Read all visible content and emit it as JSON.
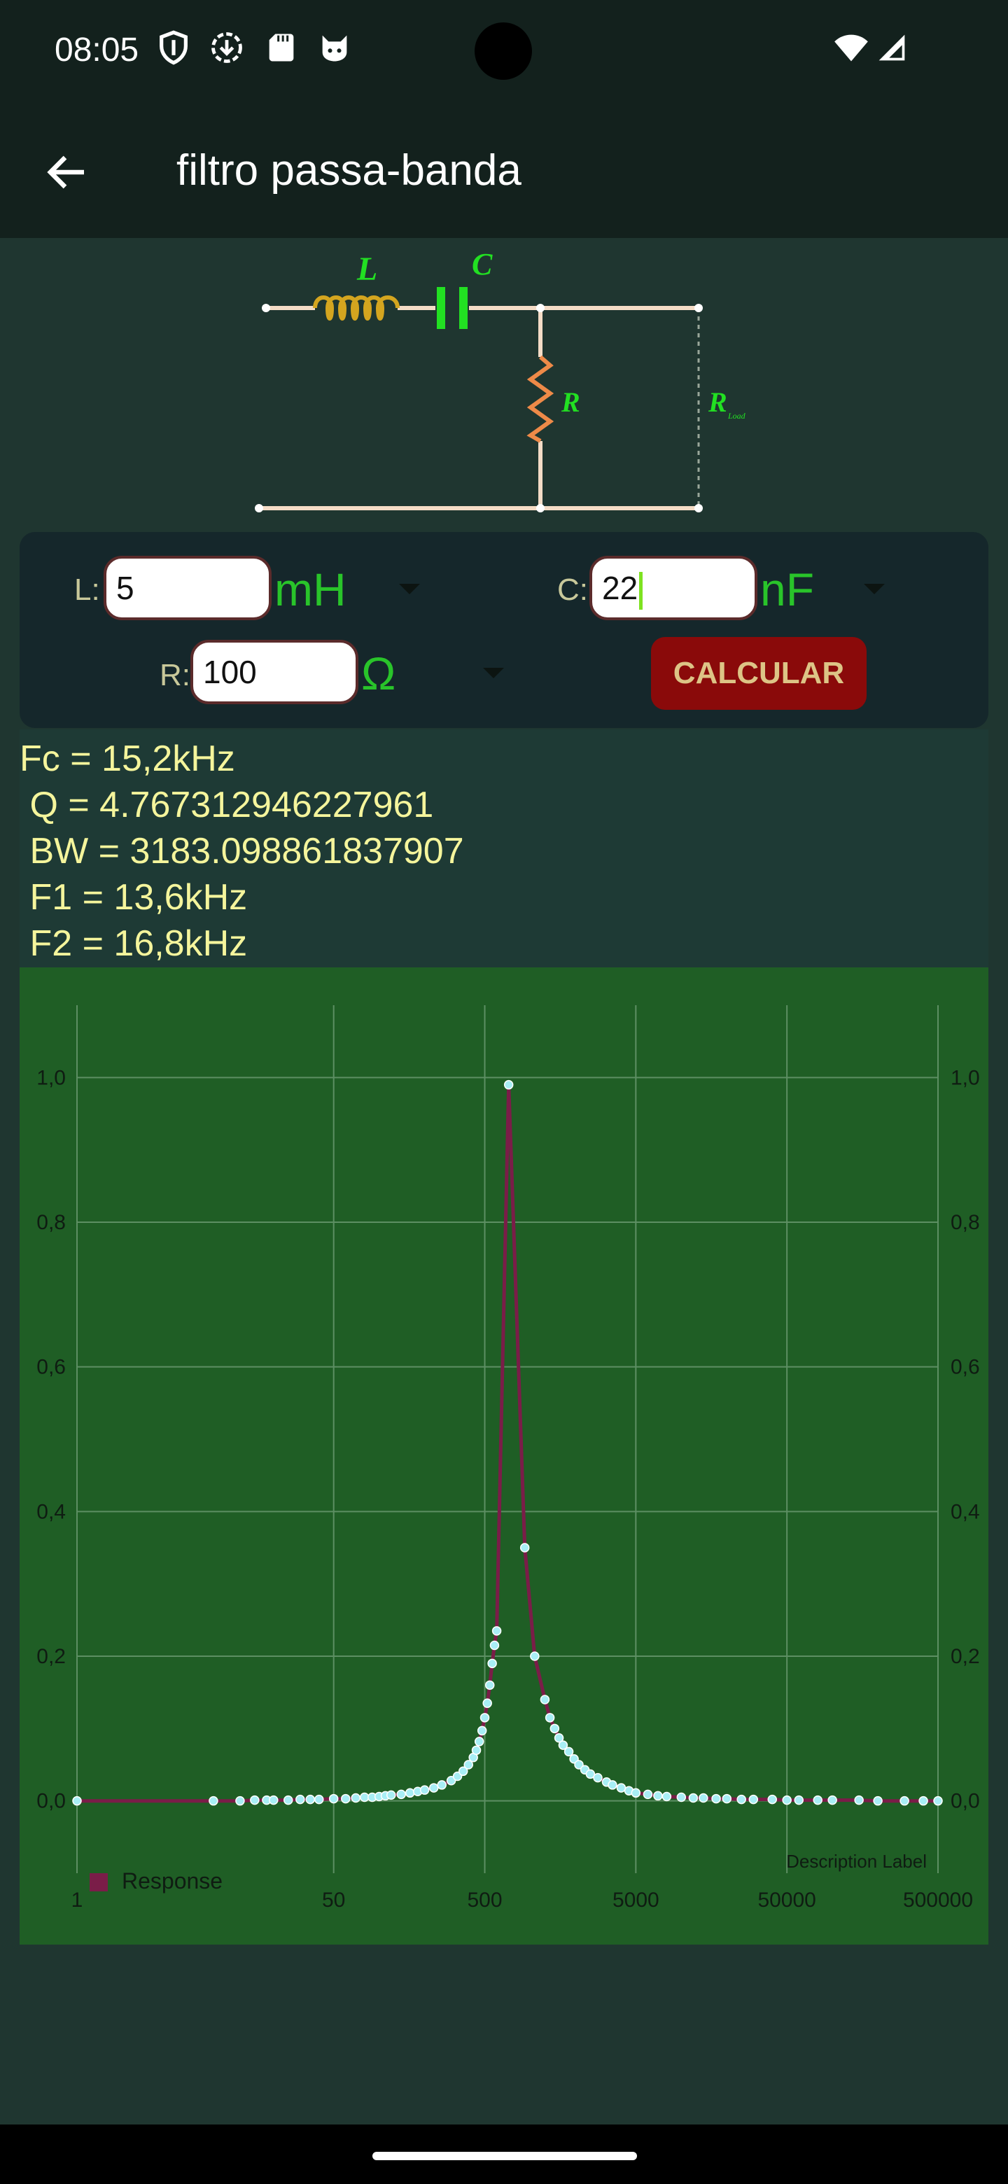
{
  "status_bar": {
    "time": "08:05",
    "icons": [
      "shield-icon",
      "download-icon",
      "sd-card-icon",
      "cat-face-icon",
      "wifi-icon",
      "signal-icon"
    ]
  },
  "app_bar": {
    "title": "filtro passa-banda",
    "back_icon": "arrow-left-icon"
  },
  "circuit": {
    "label_l": "L",
    "label_c": "C",
    "label_r": "R",
    "label_rload": "R",
    "label_rload_sub": "Load"
  },
  "form": {
    "l_label": "L:",
    "l_value": "5",
    "l_unit": "mH",
    "c_label": "C:",
    "c_value": "22",
    "c_unit": "nF",
    "r_label": "R:",
    "r_value": "100",
    "r_unit": "Ω",
    "calc_button": "CALCULAR"
  },
  "results": {
    "fc": "Fc = 15,2kHz",
    "q": " Q = 4.767312946227961",
    "bw": " BW = 3183.098861837907",
    "f1": " F1 = 13,6kHz",
    "f2": " F2 = 16,8kHz"
  },
  "chart_data": {
    "type": "line",
    "x_scale": "log",
    "x_ticks": [
      "1",
      "50",
      "500",
      "5000",
      "50000",
      "500000"
    ],
    "y_ticks": [
      "0,0",
      "0,2",
      "0,4",
      "0,6",
      "0,8",
      "1,0"
    ],
    "ylim": [
      -0.1,
      1.1
    ],
    "description_label": "Description Label",
    "legend": "Response",
    "legend_placement": "bottom-left",
    "grid": true,
    "series": [
      {
        "name": "Response",
        "points": [
          [
            1,
            0.0
          ],
          [
            8,
            0.0
          ],
          [
            12,
            0.0
          ],
          [
            15,
            0.001
          ],
          [
            18,
            0.001
          ],
          [
            20,
            0.001
          ],
          [
            25,
            0.001
          ],
          [
            30,
            0.002
          ],
          [
            35,
            0.002
          ],
          [
            40,
            0.002
          ],
          [
            50,
            0.003
          ],
          [
            60,
            0.003
          ],
          [
            70,
            0.004
          ],
          [
            80,
            0.005
          ],
          [
            90,
            0.005
          ],
          [
            100,
            0.006
          ],
          [
            110,
            0.007
          ],
          [
            120,
            0.008
          ],
          [
            140,
            0.009
          ],
          [
            160,
            0.011
          ],
          [
            180,
            0.013
          ],
          [
            200,
            0.015
          ],
          [
            230,
            0.018
          ],
          [
            260,
            0.022
          ],
          [
            300,
            0.028
          ],
          [
            330,
            0.034
          ],
          [
            360,
            0.041
          ],
          [
            390,
            0.05
          ],
          [
            420,
            0.06
          ],
          [
            440,
            0.07
          ],
          [
            460,
            0.082
          ],
          [
            480,
            0.097
          ],
          [
            500,
            0.115
          ],
          [
            520,
            0.135
          ],
          [
            540,
            0.16
          ],
          [
            560,
            0.19
          ],
          [
            580,
            0.215
          ],
          [
            600,
            0.235
          ],
          [
            720,
            0.99
          ],
          [
            920,
            0.35
          ],
          [
            1070,
            0.2
          ],
          [
            1250,
            0.14
          ],
          [
            1350,
            0.115
          ],
          [
            1450,
            0.1
          ],
          [
            1550,
            0.087
          ],
          [
            1650,
            0.077
          ],
          [
            1800,
            0.068
          ],
          [
            1950,
            0.058
          ],
          [
            2100,
            0.05
          ],
          [
            2300,
            0.043
          ],
          [
            2500,
            0.037
          ],
          [
            2800,
            0.032
          ],
          [
            3200,
            0.026
          ],
          [
            3500,
            0.022
          ],
          [
            4000,
            0.018
          ],
          [
            4500,
            0.014
          ],
          [
            5000,
            0.011
          ],
          [
            6000,
            0.009
          ],
          [
            7000,
            0.007
          ],
          [
            8000,
            0.006
          ],
          [
            10000,
            0.005
          ],
          [
            12000,
            0.004
          ],
          [
            14000,
            0.004
          ],
          [
            17000,
            0.003
          ],
          [
            20000,
            0.003
          ],
          [
            25000,
            0.002
          ],
          [
            30000,
            0.002
          ],
          [
            40000,
            0.002
          ],
          [
            50000,
            0.001
          ],
          [
            60000,
            0.001
          ],
          [
            80000,
            0.001
          ],
          [
            100000,
            0.001
          ],
          [
            150000,
            0.001
          ],
          [
            200000,
            0.0
          ],
          [
            300000,
            0.0
          ],
          [
            400000,
            0.0
          ],
          [
            500000,
            0.0
          ]
        ]
      }
    ],
    "colors": {
      "line": "#7a1d48",
      "points": "#a8eef5",
      "background": "#1f5e25",
      "grid": "#5d8f63",
      "axis_text": "#0f1c12"
    }
  }
}
